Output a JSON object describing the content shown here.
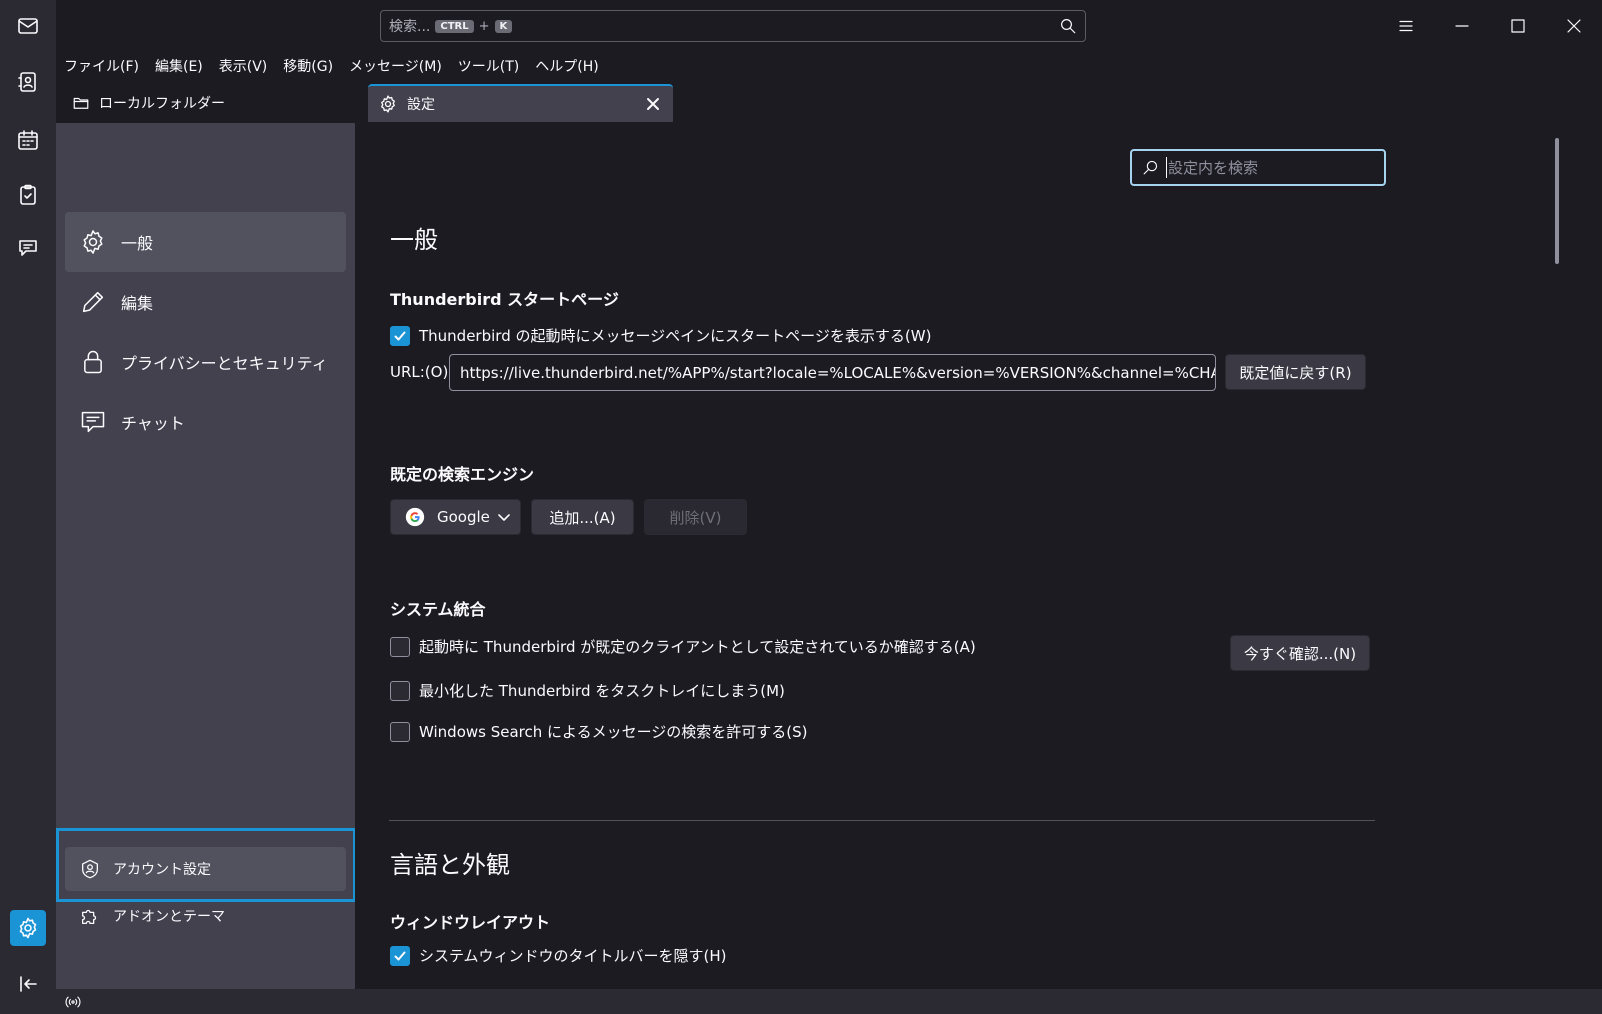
{
  "topbar": {
    "search_placeholder": "検索...",
    "kbd_ctrl": "CTRL",
    "kbd_plus": "+",
    "kbd_k": "K"
  },
  "menubar": [
    "ファイル(F)",
    "編集(E)",
    "表示(V)",
    "移動(G)",
    "メッセージ(M)",
    "ツール(T)",
    "ヘルプ(H)"
  ],
  "tabs": {
    "folder": "ローカルフォルダー",
    "settings": "設定"
  },
  "sidebar": {
    "categories": [
      "一般",
      "編集",
      "プライバシーとセキュリティ",
      "チャット"
    ],
    "account_settings": "アカウント設定",
    "addons": "アドオンとテーマ"
  },
  "content": {
    "find_placeholder": "設定内を検索",
    "section_general": "一般",
    "start_page_heading": "Thunderbird スタートページ",
    "start_page_checkbox": "Thunderbird の起動時にメッセージペインにスタートページを表示する(W)",
    "url_label": "URL:(O)",
    "url_value": "https://live.thunderbird.net/%APP%/start?locale=%LOCALE%&version=%VERSION%&channel=%CHANNEL%",
    "restore_default": "既定値に戻す(R)",
    "search_engine_heading": "既定の検索エンジン",
    "search_engine_selected": "Google",
    "add_button": "追加...(A)",
    "remove_button": "削除(V)",
    "system_integration_heading": "システム統合",
    "sys_check_default": "起動時に Thunderbird が既定のクライアントとして設定されているか確認する(A)",
    "check_now_button": "今すぐ確認...(N)",
    "sys_minimize_tray": "最小化した Thunderbird をタスクトレイにしまう(M)",
    "sys_windows_search": "Windows Search によるメッセージの検索を許可する(S)",
    "section_language": "言語と外観",
    "window_layout_heading": "ウィンドウレイアウト",
    "hide_titlebar": "システムウィンドウのタイトルバーを隠す(H)"
  },
  "colors": {
    "accent": "#1a94d4",
    "background": "#1c1b22",
    "sidebar": "#42414d",
    "spaces": "#2b2a33"
  }
}
